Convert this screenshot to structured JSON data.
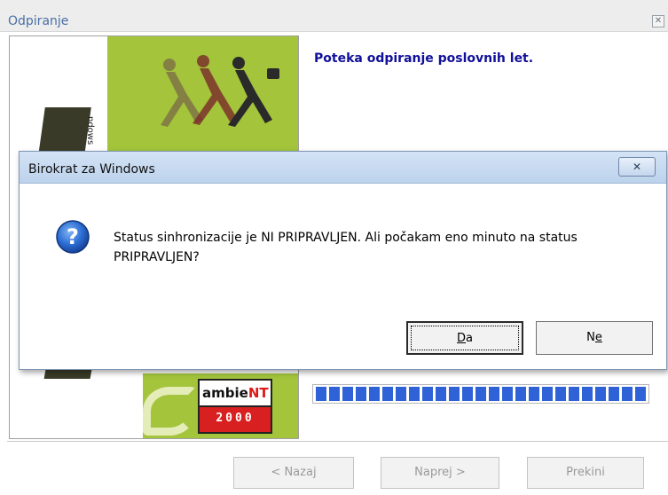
{
  "wizard": {
    "title": "Odpiranje",
    "heading": "Poteka odpiranje poslovnih let.",
    "art": {
      "vertical_text": "ndows",
      "logo_top": "ambie",
      "logo_top_accent": "NT",
      "logo_bottom": "2000"
    },
    "progress_segments": 25,
    "buttons": {
      "back": "< Nazaj",
      "next": "Naprej >",
      "cancel": "Prekini"
    },
    "icons": {
      "close": "close-icon"
    }
  },
  "message_box": {
    "title": "Birokrat za Windows",
    "text": "Status sinhronizacije je NI PRIPRAVLJEN. Ali počakam eno minuto na status PRIPRAVLJEN?",
    "icon": "question-icon",
    "buttons": {
      "yes": {
        "prefix": "",
        "underlined": "D",
        "suffix": "a"
      },
      "no": {
        "prefix": "N",
        "underlined": "e",
        "suffix": ""
      }
    }
  },
  "colors": {
    "heading": "#10109a",
    "progress": "#2f62d6",
    "art_green": "#a3c43b",
    "dialog_titlebar": "#c8dbf1"
  }
}
